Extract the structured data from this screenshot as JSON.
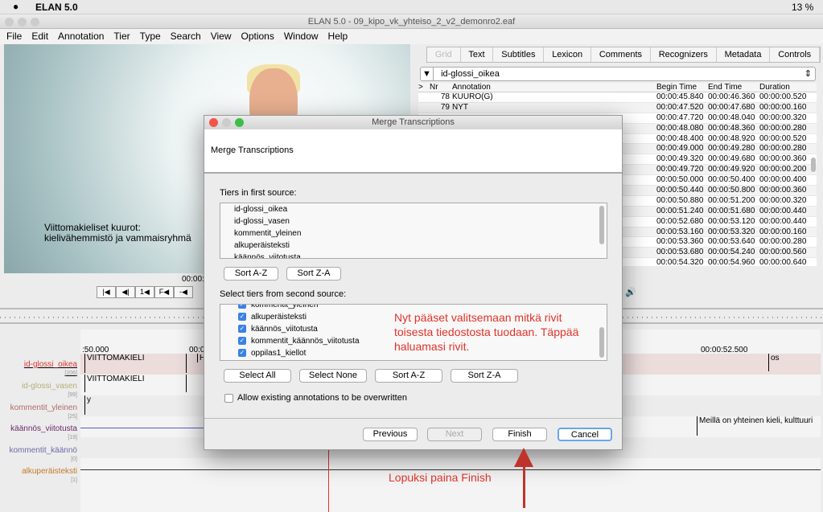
{
  "mac_menubar": {
    "app": "ELAN 5.0",
    "battery": "13 %"
  },
  "window": {
    "title": "ELAN 5.0 - 09_kipo_vk_yhteiso_2_v2_demonro2.eaf"
  },
  "menu": [
    "File",
    "Edit",
    "Annotation",
    "Tier",
    "Type",
    "Search",
    "View",
    "Options",
    "Window",
    "Help"
  ],
  "video": {
    "subtitle_line1": "Viittomakieliset kuurot:",
    "subtitle_line2": "kielivähemmistö ja vammaisryhmä",
    "time": "00:00:"
  },
  "tabs": [
    "Grid",
    "Text",
    "Subtitles",
    "Lexicon",
    "Comments",
    "Recognizers",
    "Metadata",
    "Controls"
  ],
  "grid": {
    "selected_tier": "id-glossi_oikea",
    "columns": [
      ">",
      "Nr",
      "Annotation",
      "Begin Time",
      "End Time",
      "Duration"
    ],
    "rows": [
      {
        "nr": "78",
        "annotation": "KUURO(G)",
        "begin": "00:00:45.840",
        "end": "00:00:46.360",
        "dur": "00:00:00.520"
      },
      {
        "nr": "79",
        "annotation": "NYT",
        "begin": "00:00:47.520",
        "end": "00:00:47.680",
        "dur": "00:00:00.160"
      },
      {
        "nr": "",
        "annotation": "",
        "begin": "00:00:47.720",
        "end": "00:00:48.040",
        "dur": "00:00:00.320"
      },
      {
        "nr": "",
        "annotation": "",
        "begin": "00:00:48.080",
        "end": "00:00:48.360",
        "dur": "00:00:00.280"
      },
      {
        "nr": "",
        "annotation": "",
        "begin": "00:00:48.400",
        "end": "00:00:48.920",
        "dur": "00:00:00.520"
      },
      {
        "nr": "",
        "annotation": "",
        "begin": "00:00:49.000",
        "end": "00:00:49.280",
        "dur": "00:00:00.280"
      },
      {
        "nr": "",
        "annotation": "",
        "begin": "00:00:49.320",
        "end": "00:00:49.680",
        "dur": "00:00:00.360"
      },
      {
        "nr": "",
        "annotation": "",
        "begin": "00:00:49.720",
        "end": "00:00:49.920",
        "dur": "00:00:00.200"
      },
      {
        "nr": "",
        "annotation": "",
        "begin": "00:00:50.000",
        "end": "00:00:50.400",
        "dur": "00:00:00.400"
      },
      {
        "nr": "",
        "annotation": "",
        "begin": "00:00:50.440",
        "end": "00:00:50.800",
        "dur": "00:00:00.360"
      },
      {
        "nr": "",
        "annotation": "",
        "begin": "00:00:50.880",
        "end": "00:00:51.200",
        "dur": "00:00:00.320"
      },
      {
        "nr": "",
        "annotation": "",
        "begin": "00:00:51.240",
        "end": "00:00:51.680",
        "dur": "00:00:00.440"
      },
      {
        "nr": "",
        "annotation": "",
        "begin": "00:00:52.680",
        "end": "00:00:53.120",
        "dur": "00:00:00.440"
      },
      {
        "nr": "",
        "annotation": "",
        "begin": "00:00:53.160",
        "end": "00:00:53.320",
        "dur": "00:00:00.160"
      },
      {
        "nr": "",
        "annotation": "",
        "begin": "00:00:53.360",
        "end": "00:00:53.640",
        "dur": "00:00:00.280"
      },
      {
        "nr": "",
        "annotation": "",
        "begin": "00:00:53.680",
        "end": "00:00:54.240",
        "dur": "00:00:00.560"
      },
      {
        "nr": "",
        "annotation": "",
        "begin": "00:00:54.320",
        "end": "00:00:54.960",
        "dur": "00:00:00.640"
      }
    ]
  },
  "media_controls": [
    "|◀",
    "◀|",
    "1◀",
    "F◀",
    "-◀"
  ],
  "timeline": {
    "tick_left": ":50.000",
    "tick_mid": "00:0",
    "tick_right": "00:00:52.500"
  },
  "tiers": [
    {
      "name": "id-glossi_oikea",
      "count": "[206]",
      "color": "#e0332a"
    },
    {
      "name": "id-glossi_vasen",
      "count": "[99]",
      "color": "#b3b07a"
    },
    {
      "name": "kommentit_yleinen",
      "count": "[25]",
      "color": "#b06a6a"
    },
    {
      "name": "käännös_viitotusta",
      "count": "[19]",
      "color": "#6a2a6a"
    },
    {
      "name": "kommentit_käännö",
      "count": "[0]",
      "color": "#6a6aa6"
    },
    {
      "name": "alkuperäisteksti",
      "count": "[1]",
      "color": "#c07a2a"
    }
  ],
  "annotations": {
    "a1": "VIITTOMAKIELI",
    "a1b": "H",
    "a2": "VIITTOMAKIELI",
    "a3": "y",
    "a4": "os",
    "a5": "Meillä on yhteinen kieli, kulttuuri"
  },
  "dialog": {
    "title": "Merge Transcriptions",
    "header": "Merge Transcriptions",
    "first_label": "Tiers in first source:",
    "first_tiers": [
      "id-glossi_oikea",
      "id-glossi_vasen",
      "kommentit_yleinen",
      "alkuperäisteksti",
      "käännös_viitotusta"
    ],
    "sort_az": "Sort A-Z",
    "sort_za": "Sort Z-A",
    "second_label": "Select tiers from second source:",
    "second_tiers": [
      "kommentit_yleinen",
      "alkuperäisteksti",
      "käännös_viitotusta",
      "kommentit_käännös_viitotusta",
      "oppilas1_kiellot"
    ],
    "select_all": "Select All",
    "select_none": "Select None",
    "overwrite": "Allow existing annotations to be overwritten",
    "previous": "Previous",
    "next": "Next",
    "finish": "Finish",
    "cancel": "Cancel"
  },
  "notes": {
    "note1": "Nyt pääset valitsemaan mitkä rivit toisesta tiedostosta tuodaan. Täppää haluamasi rivit.",
    "note2": "Lopuksi paina Finish"
  }
}
